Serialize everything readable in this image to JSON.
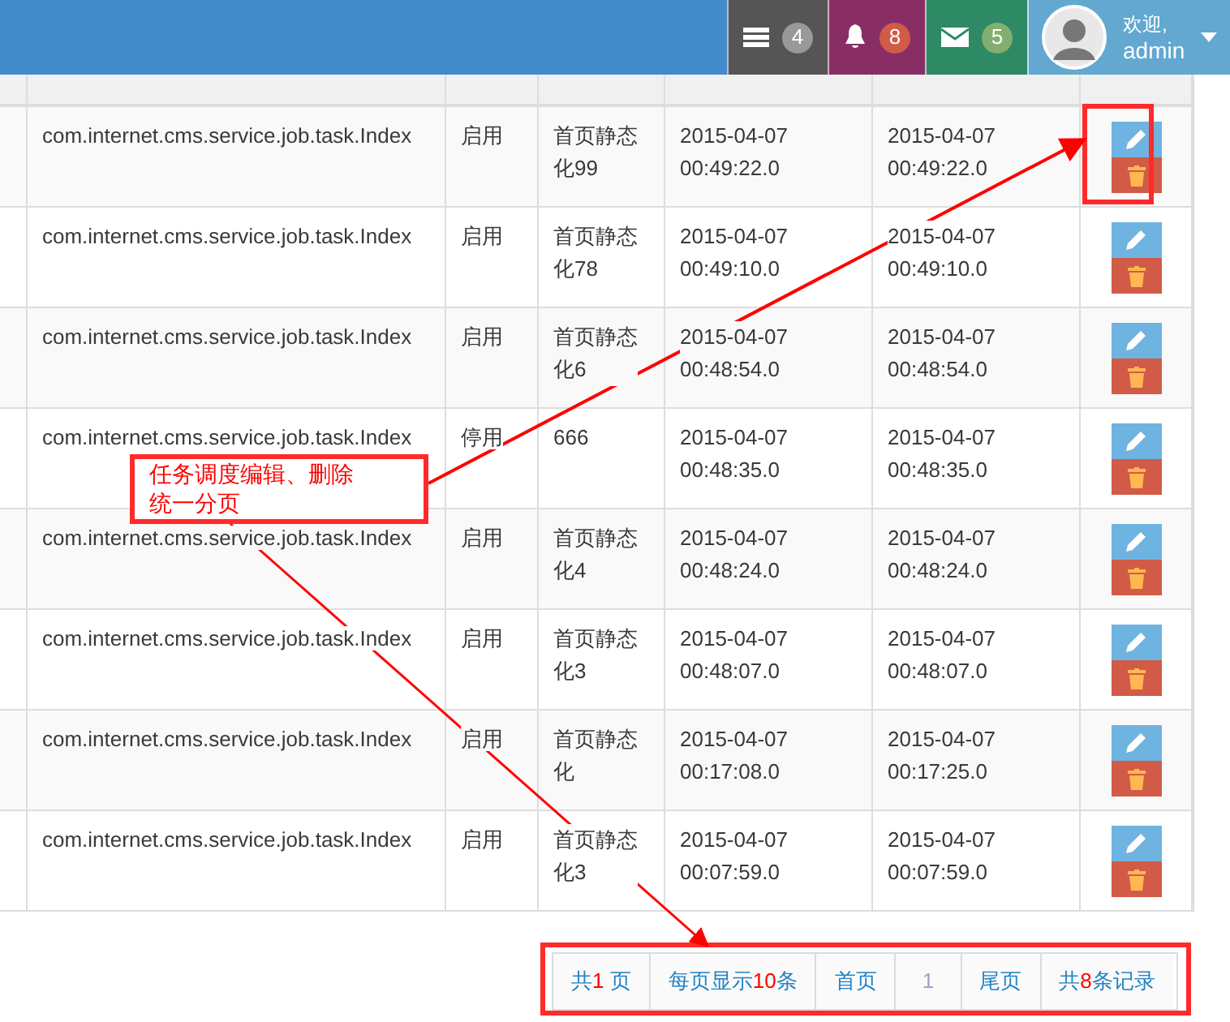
{
  "topbar": {
    "badges": [
      {
        "kind": "tasks",
        "count": "4",
        "color": "#555555"
      },
      {
        "kind": "bell",
        "count": "8",
        "color": "#892e65"
      },
      {
        "kind": "mail",
        "count": "5",
        "color": "#2e8965"
      }
    ],
    "user": {
      "greeting": "欢迎,",
      "name": "admin"
    }
  },
  "table": {
    "rows": [
      {
        "class": "com.internet.cms.service.job.task.Index",
        "status": "启用",
        "name": "首页静态化99",
        "start_date": "2015-04-07",
        "start_time": "00:49:22.0",
        "end_date": "2015-04-07",
        "end_time": "00:49:22.0"
      },
      {
        "class": "com.internet.cms.service.job.task.Index",
        "status": "启用",
        "name": "首页静态化78",
        "start_date": "2015-04-07",
        "start_time": "00:49:10.0",
        "end_date": "2015-04-07",
        "end_time": "00:49:10.0"
      },
      {
        "class": "com.internet.cms.service.job.task.Index",
        "status": "启用",
        "name": "首页静态化6",
        "start_date": "2015-04-07",
        "start_time": "00:48:54.0",
        "end_date": "2015-04-07",
        "end_time": "00:48:54.0"
      },
      {
        "class": "com.internet.cms.service.job.task.Index",
        "status": "停用",
        "name": "666",
        "start_date": "2015-04-07",
        "start_time": "00:48:35.0",
        "end_date": "2015-04-07",
        "end_time": "00:48:35.0"
      },
      {
        "class": "com.internet.cms.service.job.task.Index",
        "status": "启用",
        "name": "首页静态化4",
        "start_date": "2015-04-07",
        "start_time": "00:48:24.0",
        "end_date": "2015-04-07",
        "end_time": "00:48:24.0"
      },
      {
        "class": "com.internet.cms.service.job.task.Index",
        "status": "启用",
        "name": "首页静态化3",
        "start_date": "2015-04-07",
        "start_time": "00:48:07.0",
        "end_date": "2015-04-07",
        "end_time": "00:48:07.0"
      },
      {
        "class": "com.internet.cms.service.job.task.Index",
        "status": "启用",
        "name": "首页静态化",
        "start_date": "2015-04-07",
        "start_time": "00:17:08.0",
        "end_date": "2015-04-07",
        "end_time": "00:17:25.0"
      },
      {
        "class": "com.internet.cms.service.job.task.Index",
        "status": "启用",
        "name": "首页静态化3",
        "start_date": "2015-04-07",
        "start_time": "00:07:59.0",
        "end_date": "2015-04-07",
        "end_time": "00:07:59.0"
      }
    ]
  },
  "pagination": [
    {
      "kind": "count",
      "prefix": "共",
      "number": "1",
      "suffix": " 页"
    },
    {
      "kind": "count",
      "prefix": "每页显示",
      "number": "10",
      "suffix": "条"
    },
    {
      "kind": "link",
      "label": "首页"
    },
    {
      "kind": "page",
      "label": "1",
      "selected": true
    },
    {
      "kind": "link",
      "label": "尾页"
    },
    {
      "kind": "count",
      "prefix": "共",
      "number": "8",
      "suffix": "条记录"
    }
  ],
  "annotation": {
    "lines": [
      "任务调度编辑、删除",
      "统一分页"
    ]
  }
}
